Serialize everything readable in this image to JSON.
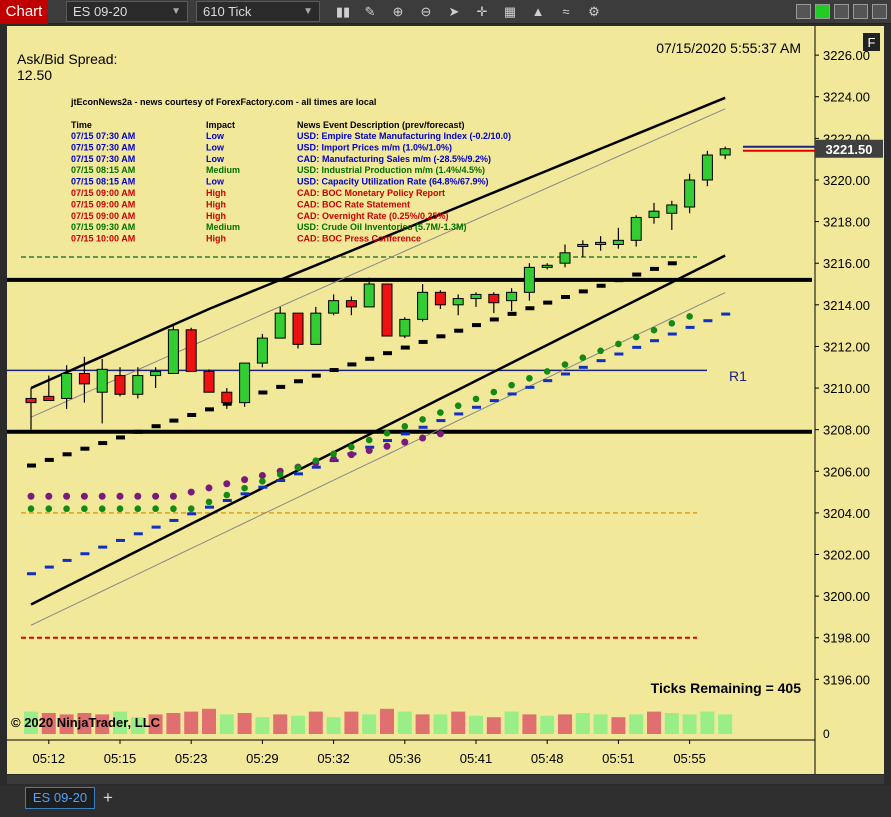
{
  "toolbar": {
    "chart_tab": "Chart",
    "instrument": "ES 09-20",
    "interval": "610 Tick",
    "icons": [
      "bar-type-icon",
      "draw-pencil-icon",
      "zoom-in-icon",
      "zoom-out-icon",
      "pointer-icon",
      "crosshair-icon",
      "data-series-icon",
      "indicators-icon",
      "strategies-icon",
      "properties-icon"
    ]
  },
  "chart": {
    "ask_bid_label": "Ask/Bid Spread:",
    "ask_bid_value": "12.50",
    "datetime": "07/15/2020 5:55:37 AM",
    "f_button": "F",
    "news_title": "jtEconNews2a - news courtesy of ForexFactory.com - all times are local",
    "news_headers": [
      "Time",
      "Impact",
      "News Event Description (prev/forecast)"
    ],
    "news": [
      {
        "time": "07/15 07:30 AM",
        "impact": "Low",
        "desc": "USD: Empire State Manufacturing Index (-0.2/10.0)",
        "color": "#0000cc"
      },
      {
        "time": "07/15 07:30 AM",
        "impact": "Low",
        "desc": "USD: Import Prices m/m (1.0%/1.0%)",
        "color": "#0000cc"
      },
      {
        "time": "07/15 07:30 AM",
        "impact": "Low",
        "desc": "CAD: Manufacturing Sales m/m (-28.5%/9.2%)",
        "color": "#0000cc"
      },
      {
        "time": "07/15 08:15 AM",
        "impact": "Medium",
        "desc": "USD: Industrial Production m/m (1.4%/4.5%)",
        "color": "#007000"
      },
      {
        "time": "07/15 08:15 AM",
        "impact": "Low",
        "desc": "USD: Capacity Utilization Rate (64.8%/67.9%)",
        "color": "#0000cc"
      },
      {
        "time": "07/15 09:00 AM",
        "impact": "High",
        "desc": "CAD: BOC Monetary Policy Report",
        "color": "#cc0000"
      },
      {
        "time": "07/15 09:00 AM",
        "impact": "High",
        "desc": "CAD: BOC Rate Statement",
        "color": "#cc0000"
      },
      {
        "time": "07/15 09:00 AM",
        "impact": "High",
        "desc": "CAD: Overnight Rate (0.25%/0.25%)",
        "color": "#cc0000"
      },
      {
        "time": "07/15 09:30 AM",
        "impact": "Medium",
        "desc": "USD: Crude Oil Inventories (5.7M/-1.3M)",
        "color": "#007000"
      },
      {
        "time": "07/15 10:00 AM",
        "impact": "High",
        "desc": "CAD: BOC Press Conference",
        "color": "#cc0000"
      }
    ],
    "r1_label": "R1",
    "ticks_remaining": "Ticks Remaining = 405",
    "copyright": "© 2020 NinjaTrader, LLC",
    "price_tag": "3221.50",
    "volume_axis_label": "0"
  },
  "chart_data": {
    "type": "candlestick",
    "y_ticks": [
      "3196.00",
      "3198.00",
      "3200.00",
      "3202.00",
      "3204.00",
      "3206.00",
      "3208.00",
      "3210.00",
      "3212.00",
      "3214.00",
      "3216.00",
      "3218.00",
      "3220.00",
      "3222.00",
      "3224.00",
      "3226.00"
    ],
    "ylim": [
      3195.2,
      3227.4
    ],
    "x_ticks": [
      {
        "label": "05:12",
        "bar": 1
      },
      {
        "label": "05:15",
        "bar": 5
      },
      {
        "label": "05:23",
        "bar": 9
      },
      {
        "label": "05:29",
        "bar": 13
      },
      {
        "label": "05:32",
        "bar": 17
      },
      {
        "label": "05:36",
        "bar": 21
      },
      {
        "label": "05:41",
        "bar": 25
      },
      {
        "label": "05:48",
        "bar": 29
      },
      {
        "label": "05:51",
        "bar": 33
      },
      {
        "label": "05:55",
        "bar": 37
      }
    ],
    "candles": [
      {
        "o": 3209.5,
        "h": 3210.0,
        "l": 3208.0,
        "c": 3209.3
      },
      {
        "o": 3209.6,
        "h": 3210.6,
        "l": 3209.4,
        "c": 3209.4
      },
      {
        "o": 3209.5,
        "h": 3211.1,
        "l": 3209.0,
        "c": 3210.7
      },
      {
        "o": 3210.7,
        "h": 3211.5,
        "l": 3209.3,
        "c": 3210.2
      },
      {
        "o": 3209.8,
        "h": 3211.4,
        "l": 3208.3,
        "c": 3210.9
      },
      {
        "o": 3210.6,
        "h": 3211.0,
        "l": 3209.6,
        "c": 3209.7
      },
      {
        "o": 3209.7,
        "h": 3211.0,
        "l": 3209.5,
        "c": 3210.6
      },
      {
        "o": 3210.6,
        "h": 3211.0,
        "l": 3210.0,
        "c": 3210.8
      },
      {
        "o": 3210.7,
        "h": 3213.0,
        "l": 3210.7,
        "c": 3212.8
      },
      {
        "o": 3212.8,
        "h": 3212.9,
        "l": 3210.8,
        "c": 3210.8
      },
      {
        "o": 3210.8,
        "h": 3210.9,
        "l": 3209.8,
        "c": 3209.8
      },
      {
        "o": 3209.8,
        "h": 3210.0,
        "l": 3209.0,
        "c": 3209.3
      },
      {
        "o": 3209.3,
        "h": 3211.2,
        "l": 3209.1,
        "c": 3211.2
      },
      {
        "o": 3211.2,
        "h": 3212.6,
        "l": 3211.0,
        "c": 3212.4
      },
      {
        "o": 3212.4,
        "h": 3213.9,
        "l": 3212.4,
        "c": 3213.6
      },
      {
        "o": 3213.6,
        "h": 3213.6,
        "l": 3211.9,
        "c": 3212.1
      },
      {
        "o": 3212.1,
        "h": 3213.9,
        "l": 3212.1,
        "c": 3213.6
      },
      {
        "o": 3213.6,
        "h": 3214.5,
        "l": 3213.5,
        "c": 3214.2
      },
      {
        "o": 3214.2,
        "h": 3214.4,
        "l": 3213.5,
        "c": 3213.9
      },
      {
        "o": 3213.9,
        "h": 3215.3,
        "l": 3213.9,
        "c": 3215.0
      },
      {
        "o": 3215.0,
        "h": 3215.0,
        "l": 3212.5,
        "c": 3212.5
      },
      {
        "o": 3212.5,
        "h": 3213.4,
        "l": 3212.4,
        "c": 3213.3
      },
      {
        "o": 3213.3,
        "h": 3215.0,
        "l": 3213.2,
        "c": 3214.6
      },
      {
        "o": 3214.6,
        "h": 3214.7,
        "l": 3213.8,
        "c": 3214.0
      },
      {
        "o": 3214.0,
        "h": 3214.5,
        "l": 3213.5,
        "c": 3214.3
      },
      {
        "o": 3214.3,
        "h": 3214.6,
        "l": 3213.9,
        "c": 3214.5
      },
      {
        "o": 3214.5,
        "h": 3214.6,
        "l": 3213.6,
        "c": 3214.1
      },
      {
        "o": 3214.2,
        "h": 3214.8,
        "l": 3213.7,
        "c": 3214.6
      },
      {
        "o": 3214.6,
        "h": 3216.0,
        "l": 3214.2,
        "c": 3215.8
      },
      {
        "o": 3215.8,
        "h": 3216.0,
        "l": 3215.7,
        "c": 3215.9
      },
      {
        "o": 3216.0,
        "h": 3216.9,
        "l": 3215.8,
        "c": 3216.5
      },
      {
        "o": 3216.9,
        "h": 3217.1,
        "l": 3216.3,
        "c": 3216.9
      },
      {
        "o": 3216.9,
        "h": 3217.3,
        "l": 3216.6,
        "c": 3217.0
      },
      {
        "o": 3216.9,
        "h": 3217.7,
        "l": 3216.7,
        "c": 3217.1
      },
      {
        "o": 3217.1,
        "h": 3218.3,
        "l": 3216.8,
        "c": 3218.2
      },
      {
        "o": 3218.2,
        "h": 3218.9,
        "l": 3217.9,
        "c": 3218.5
      },
      {
        "o": 3218.4,
        "h": 3219.0,
        "l": 3217.6,
        "c": 3218.8
      },
      {
        "o": 3218.7,
        "h": 3220.3,
        "l": 3218.4,
        "c": 3220.0
      },
      {
        "o": 3220.0,
        "h": 3221.4,
        "l": 3219.7,
        "c": 3221.2
      },
      {
        "o": 3221.2,
        "h": 3221.6,
        "l": 3221.0,
        "c": 3221.5
      }
    ],
    "horizontal_lines": [
      {
        "price": 3215.2,
        "color": "#000000",
        "style": "solid",
        "width": 4
      },
      {
        "price": 3207.9,
        "color": "#000000",
        "style": "solid",
        "width": 4
      },
      {
        "price": 3210.85,
        "color": "#1a237e",
        "style": "solid",
        "width": 1.5
      },
      {
        "price": 3216.3,
        "color": "#2e7d32",
        "style": "dashed",
        "width": 1.5
      },
      {
        "price": 3204.0,
        "color": "#e0a020",
        "style": "dashed",
        "width": 1.5
      },
      {
        "price": 3198.0,
        "color": "#e00000",
        "style": "dashed",
        "width": 2
      }
    ],
    "last_price": 3221.5,
    "volume": {
      "ylim": [
        0,
        1.4
      ],
      "bars": [
        {
          "v": 0.8,
          "up": true
        },
        {
          "v": 0.75,
          "up": false
        },
        {
          "v": 0.7,
          "up": false
        },
        {
          "v": 0.75,
          "up": false
        },
        {
          "v": 0.7,
          "up": false
        },
        {
          "v": 0.8,
          "up": true
        },
        {
          "v": 0.6,
          "up": true
        },
        {
          "v": 0.7,
          "up": false
        },
        {
          "v": 0.75,
          "up": false
        },
        {
          "v": 0.8,
          "up": false
        },
        {
          "v": 0.9,
          "up": false
        },
        {
          "v": 0.7,
          "up": true
        },
        {
          "v": 0.75,
          "up": false
        },
        {
          "v": 0.6,
          "up": true
        },
        {
          "v": 0.7,
          "up": false
        },
        {
          "v": 0.65,
          "up": true
        },
        {
          "v": 0.8,
          "up": false
        },
        {
          "v": 0.6,
          "up": true
        },
        {
          "v": 0.8,
          "up": false
        },
        {
          "v": 0.7,
          "up": true
        },
        {
          "v": 0.9,
          "up": false
        },
        {
          "v": 0.8,
          "up": true
        },
        {
          "v": 0.7,
          "up": false
        },
        {
          "v": 0.7,
          "up": true
        },
        {
          "v": 0.8,
          "up": false
        },
        {
          "v": 0.65,
          "up": true
        },
        {
          "v": 0.6,
          "up": false
        },
        {
          "v": 0.8,
          "up": true
        },
        {
          "v": 0.7,
          "up": false
        },
        {
          "v": 0.65,
          "up": true
        },
        {
          "v": 0.7,
          "up": false
        },
        {
          "v": 0.75,
          "up": true
        },
        {
          "v": 0.7,
          "up": true
        },
        {
          "v": 0.6,
          "up": false
        },
        {
          "v": 0.7,
          "up": true
        },
        {
          "v": 0.8,
          "up": false
        },
        {
          "v": 0.75,
          "up": true
        },
        {
          "v": 0.7,
          "up": true
        },
        {
          "v": 0.8,
          "up": true
        },
        {
          "v": 0.7,
          "up": true
        }
      ]
    }
  },
  "tabs": {
    "active": "ES 09-20",
    "add": "+"
  },
  "colors": {
    "chart_bg": "#f2e89a",
    "up_candle": "#33cc33",
    "down_candle": "#ee1111",
    "vol_up": "#99ee88",
    "vol_down": "#e07070",
    "price_tag_bg": "#404040"
  }
}
